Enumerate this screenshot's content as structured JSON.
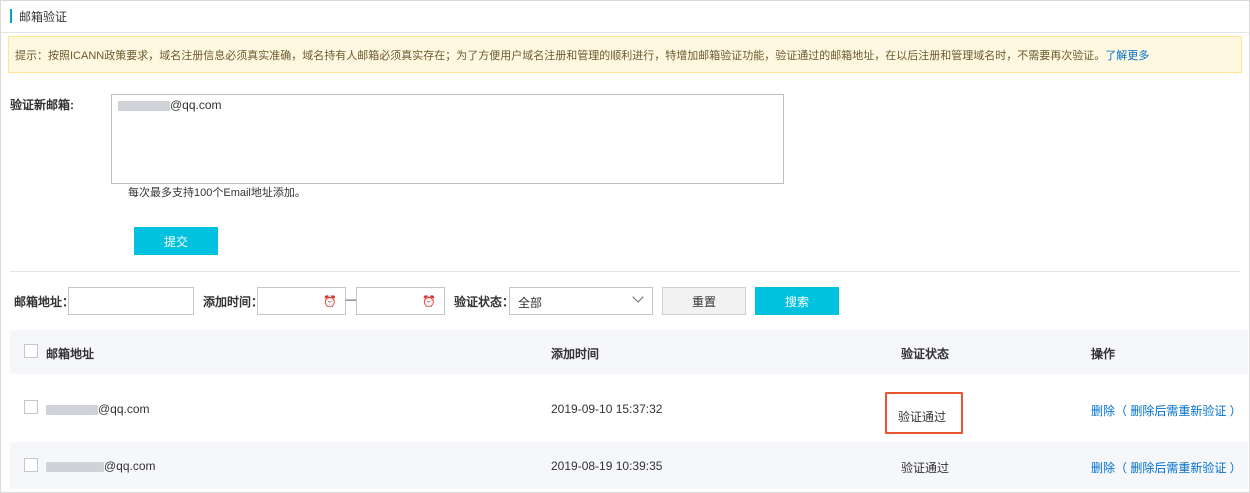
{
  "title": "邮箱验证",
  "notice": {
    "text": "提示：按照ICANN政策要求，域名注册信息必须真实准确，域名持有人邮箱必须真实存在；为了方便用户域名注册和管理的顺利进行，特增加邮箱验证功能，验证通过的邮箱地址，在以后注册和管理域名时，不需要再次验证。",
    "link": "了解更多"
  },
  "form": {
    "label": "验证新邮箱:",
    "textarea_value_suffix": "@qq.com",
    "hint": "每次最多支持100个Email地址添加。",
    "submit": "提交"
  },
  "filter": {
    "email_label": "邮箱地址：",
    "time_label": "添加时间：",
    "dash": "—",
    "status_label": "验证状态：",
    "status_value": "全部",
    "reset": "重置",
    "search": "搜索"
  },
  "table": {
    "headers": [
      "邮箱地址",
      "添加时间",
      "验证状态",
      "操作"
    ],
    "rows": [
      {
        "email_suffix": "@qq.com",
        "time": "2019-09-10 15:37:32",
        "status": "验证通过",
        "action": "删除（ 删除后需重新验证 ）"
      },
      {
        "email_suffix": "@qq.com",
        "time": "2019-08-19 10:39:35",
        "status": "验证通过",
        "action": "删除（ 删除后需重新验证 ）"
      }
    ]
  },
  "colors": {
    "accent": "#00c1de",
    "link": "#0070cc",
    "highlight": "#e8552f"
  }
}
